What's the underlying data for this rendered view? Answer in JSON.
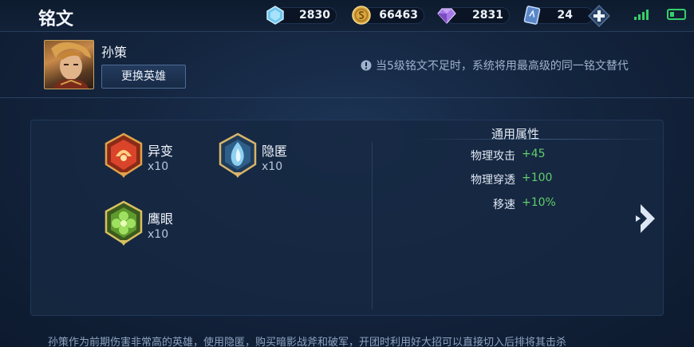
{
  "header": {
    "title": "铭文",
    "resources": [
      {
        "icon": "diamond-icon",
        "value": "2830"
      },
      {
        "icon": "gold-coin-icon",
        "value": "66463"
      },
      {
        "icon": "gem-icon",
        "value": "2831"
      },
      {
        "icon": "ticket-icon",
        "value": "24"
      }
    ]
  },
  "hero": {
    "name": "孙策",
    "change_button": "更换英雄",
    "notice": "当5级铭文不足时，系统将用最高级的同一铭文替代"
  },
  "runes": [
    {
      "name": "异变",
      "count": "x10",
      "color": "#d9442a"
    },
    {
      "name": "隐匿",
      "count": "x10",
      "color": "#8fd0f0"
    },
    {
      "name": "鹰眼",
      "count": "x10",
      "color": "#7fcf4a"
    }
  ],
  "attributes": {
    "title": "通用属性",
    "items": [
      {
        "name": "物理攻击",
        "value": "+45"
      },
      {
        "name": "物理穿透",
        "value": "+100"
      },
      {
        "name": "移速",
        "value": "+10%"
      }
    ]
  },
  "description": "孙策作为前期伤害非常高的英雄，使用隐匿，购买暗影战斧和破军，开团时利用好大招可以直接切入后排将其击杀",
  "colors": {
    "accent_green": "#5fcf6a",
    "gold_border": "#c9a45e"
  }
}
